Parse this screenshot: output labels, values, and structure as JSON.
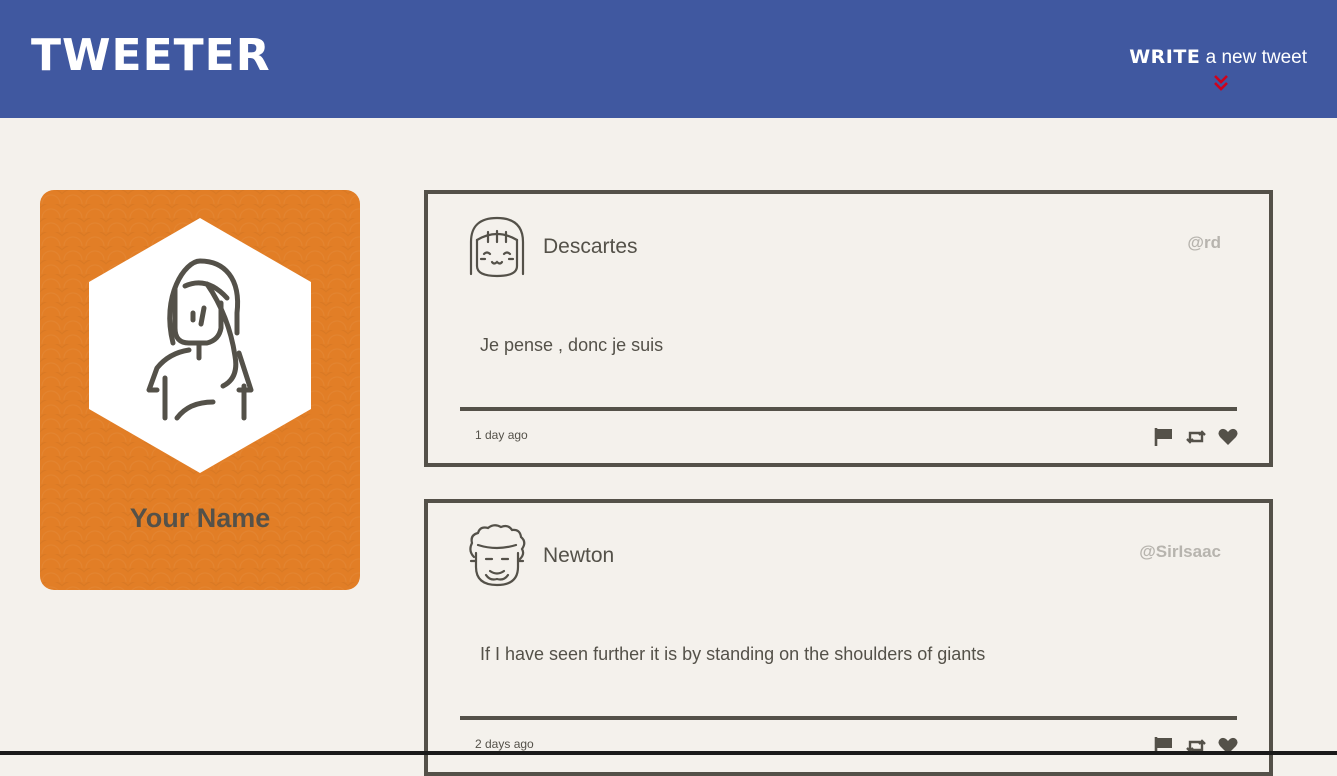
{
  "nav": {
    "brand": "TWEETER",
    "compose_strong": "WRITE",
    "compose_rest": " a new tweet"
  },
  "profile": {
    "name": "Your Name"
  },
  "tweets": [
    {
      "author": "Descartes",
      "handle": "@rd",
      "content": "Je pense , donc je suis",
      "age": "1 day ago"
    },
    {
      "author": "Newton",
      "handle": "@SirIsaac",
      "content": "If I have seen further it is by standing on the shoulders of giants",
      "age": "2 days ago"
    }
  ],
  "icons": {
    "flag": "flag-icon",
    "retweet": "retweet-icon",
    "like": "heart-icon"
  },
  "colors": {
    "nav": "#4058a0",
    "page": "#f4f1ec",
    "profile_card": "#e27e26",
    "text": "#545149",
    "handle": "#b7b4ae",
    "chevron": "#d0021b"
  }
}
